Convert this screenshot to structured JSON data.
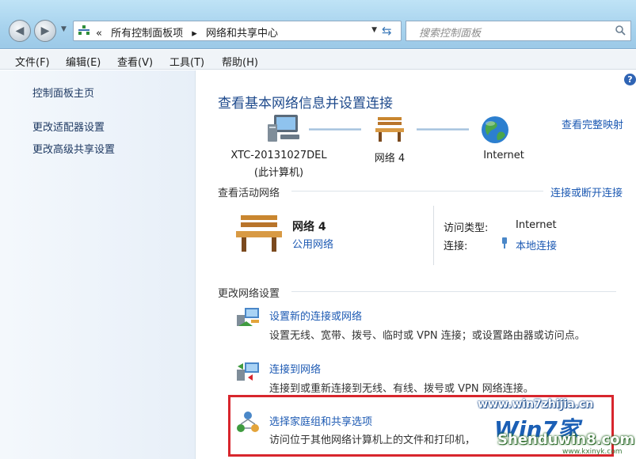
{
  "address_bar": {
    "crumbs": [
      "所有控制面板项",
      "网络和共享中心"
    ],
    "search_placeholder": "搜索控制面板"
  },
  "menu": {
    "items": [
      "文件(F)",
      "编辑(E)",
      "查看(V)",
      "工具(T)",
      "帮助(H)"
    ]
  },
  "sidebar": {
    "items": [
      "控制面板主页",
      "更改适配器设置",
      "更改高级共享设置"
    ]
  },
  "main": {
    "title": "查看基本网络信息并设置连接",
    "view_full_map": "查看完整映射",
    "map": {
      "computer_name": "XTC-20131027DEL",
      "computer_sub": "(此计算机)",
      "network_name": "网络 4",
      "internet_label": "Internet"
    },
    "active_networks": {
      "heading": "查看活动网络",
      "connect_disconnect": "连接或断开连接",
      "network_name": "网络 4",
      "network_type": "公用网络",
      "access_type_label": "访问类型:",
      "access_type_value": "Internet",
      "connections_label": "连接:",
      "connections_value": "本地连接"
    },
    "change_settings": {
      "heading": "更改网络设置",
      "options": [
        {
          "title": "设置新的连接或网络",
          "desc": "设置无线、宽带、拨号、临时或 VPN 连接；或设置路由器或访问点。",
          "icon": "network-setup-icon"
        },
        {
          "title": "连接到网络",
          "desc": "连接到或重新连接到无线、有线、拨号或 VPN 网络连接。",
          "icon": "connect-network-icon"
        },
        {
          "title": "选择家庭组和共享选项",
          "desc": "访问位于其他网络计算机上的文件和打印机，",
          "icon": "homegroup-icon"
        }
      ]
    }
  },
  "watermark": {
    "url": "www.win7zhijia.cn",
    "logo": "Win7家",
    "site": "Shenduwin8.com",
    "small": "www.kxinyk.com"
  },
  "colors": {
    "link": "#1d5ab3",
    "title": "#1e4a8c",
    "highlight": "#d8262d"
  }
}
